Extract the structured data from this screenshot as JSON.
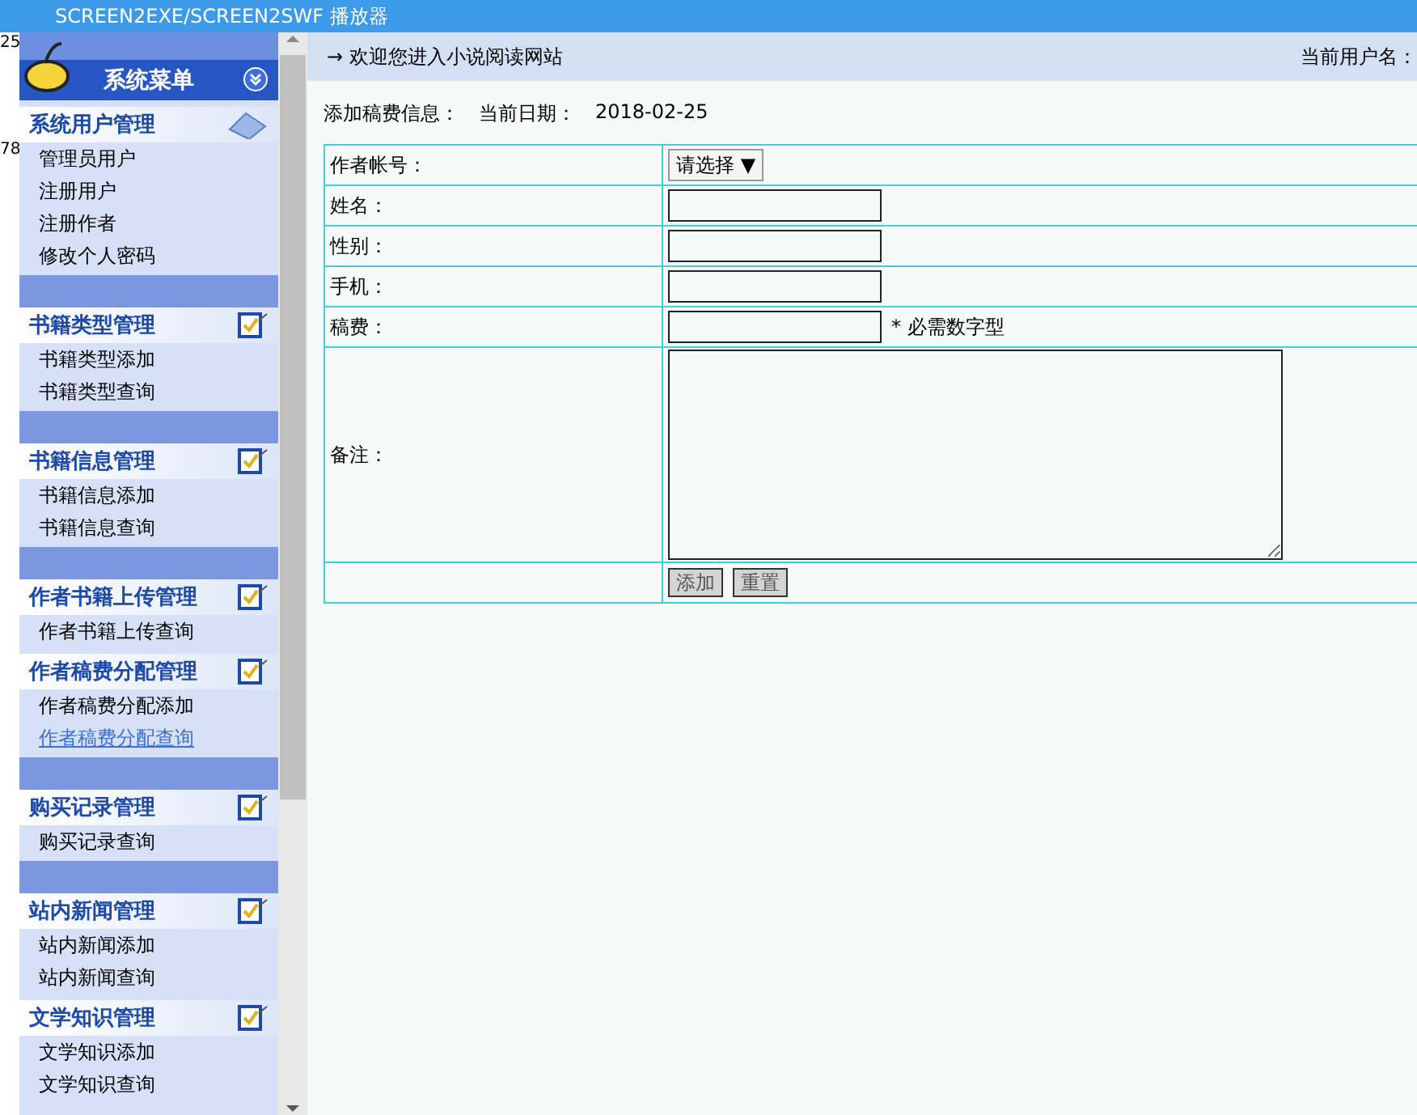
{
  "window": {
    "title": "SCREEN2EXE/SCREEN2SWF 播放器"
  },
  "background_fragments": [
    "25",
    "78"
  ],
  "sidebar": {
    "title": "系统菜单",
    "groups": [
      {
        "title": "系统用户管理",
        "spacer_before": false,
        "items": [
          {
            "label": "管理员用户",
            "selected": false
          },
          {
            "label": "注册用户",
            "selected": false
          },
          {
            "label": "注册作者",
            "selected": false
          },
          {
            "label": "修改个人密码",
            "selected": false
          }
        ]
      },
      {
        "title": "书籍类型管理",
        "spacer_before": true,
        "items": [
          {
            "label": "书籍类型添加",
            "selected": false
          },
          {
            "label": "书籍类型查询",
            "selected": false
          }
        ]
      },
      {
        "title": "书籍信息管理",
        "spacer_before": true,
        "items": [
          {
            "label": "书籍信息添加",
            "selected": false
          },
          {
            "label": "书籍信息查询",
            "selected": false
          }
        ]
      },
      {
        "title": "作者书籍上传管理",
        "spacer_before": true,
        "items": [
          {
            "label": "作者书籍上传查询",
            "selected": false
          }
        ]
      },
      {
        "title": "作者稿费分配管理",
        "spacer_before": false,
        "items": [
          {
            "label": "作者稿费分配添加",
            "selected": false
          },
          {
            "label": "作者稿费分配查询",
            "selected": true
          }
        ]
      },
      {
        "title": "购买记录管理",
        "spacer_before": true,
        "items": [
          {
            "label": "购买记录查询",
            "selected": false
          }
        ]
      },
      {
        "title": "站内新闻管理",
        "spacer_before": true,
        "items": [
          {
            "label": "站内新闻添加",
            "selected": false
          },
          {
            "label": "站内新闻查询",
            "selected": false
          }
        ]
      },
      {
        "title": "文学知识管理",
        "spacer_before": false,
        "items": [
          {
            "label": "文学知识添加",
            "selected": false
          },
          {
            "label": "文学知识查询",
            "selected": false
          }
        ]
      }
    ]
  },
  "top_bar": {
    "welcome": "→ 欢迎您进入小说阅读网站",
    "user_label": "当前用户名："
  },
  "form": {
    "title": "添加稿费信息：",
    "date_label": "当前日期：",
    "date": "2018-02-25",
    "rows": [
      {
        "kind": "select",
        "label": "作者帐号：",
        "value": "请选择 ▼"
      },
      {
        "kind": "text",
        "label": "姓名："
      },
      {
        "kind": "text",
        "label": "性别："
      },
      {
        "kind": "text",
        "label": "手机："
      },
      {
        "kind": "text",
        "label": "稿费：",
        "note": "* 必需数字型"
      },
      {
        "kind": "textarea",
        "label": "备注："
      },
      {
        "kind": "buttons",
        "buttons": [
          "添加",
          "重置"
        ]
      }
    ]
  }
}
